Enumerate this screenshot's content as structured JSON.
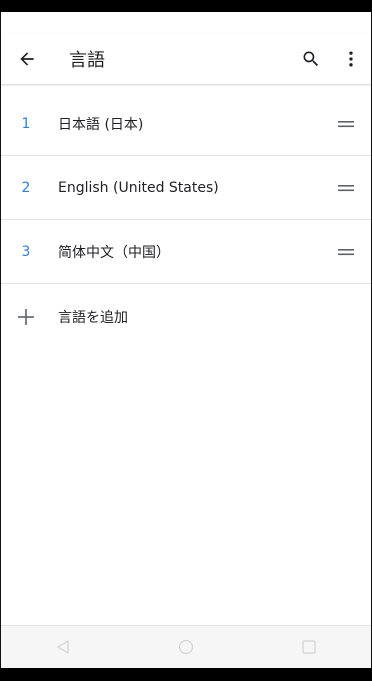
{
  "appbar": {
    "title": "言語",
    "back_icon": "arrow-back-icon",
    "search_icon": "search-icon",
    "more_icon": "more-vert-icon"
  },
  "languages": [
    {
      "index": "1",
      "label": "日本語 (日本)"
    },
    {
      "index": "2",
      "label": "English (United States)"
    },
    {
      "index": "3",
      "label": "简体中文（中国）"
    }
  ],
  "add_language": {
    "label": "言語を追加",
    "icon": "plus-icon"
  },
  "navbar": {
    "back_icon": "nav-back-icon",
    "home_icon": "nav-home-icon",
    "recents_icon": "nav-recents-icon"
  },
  "colors": {
    "accent": "#2f7fd6",
    "text": "#202124",
    "icon": "#5f6368",
    "divider": "#e2e2e2"
  }
}
